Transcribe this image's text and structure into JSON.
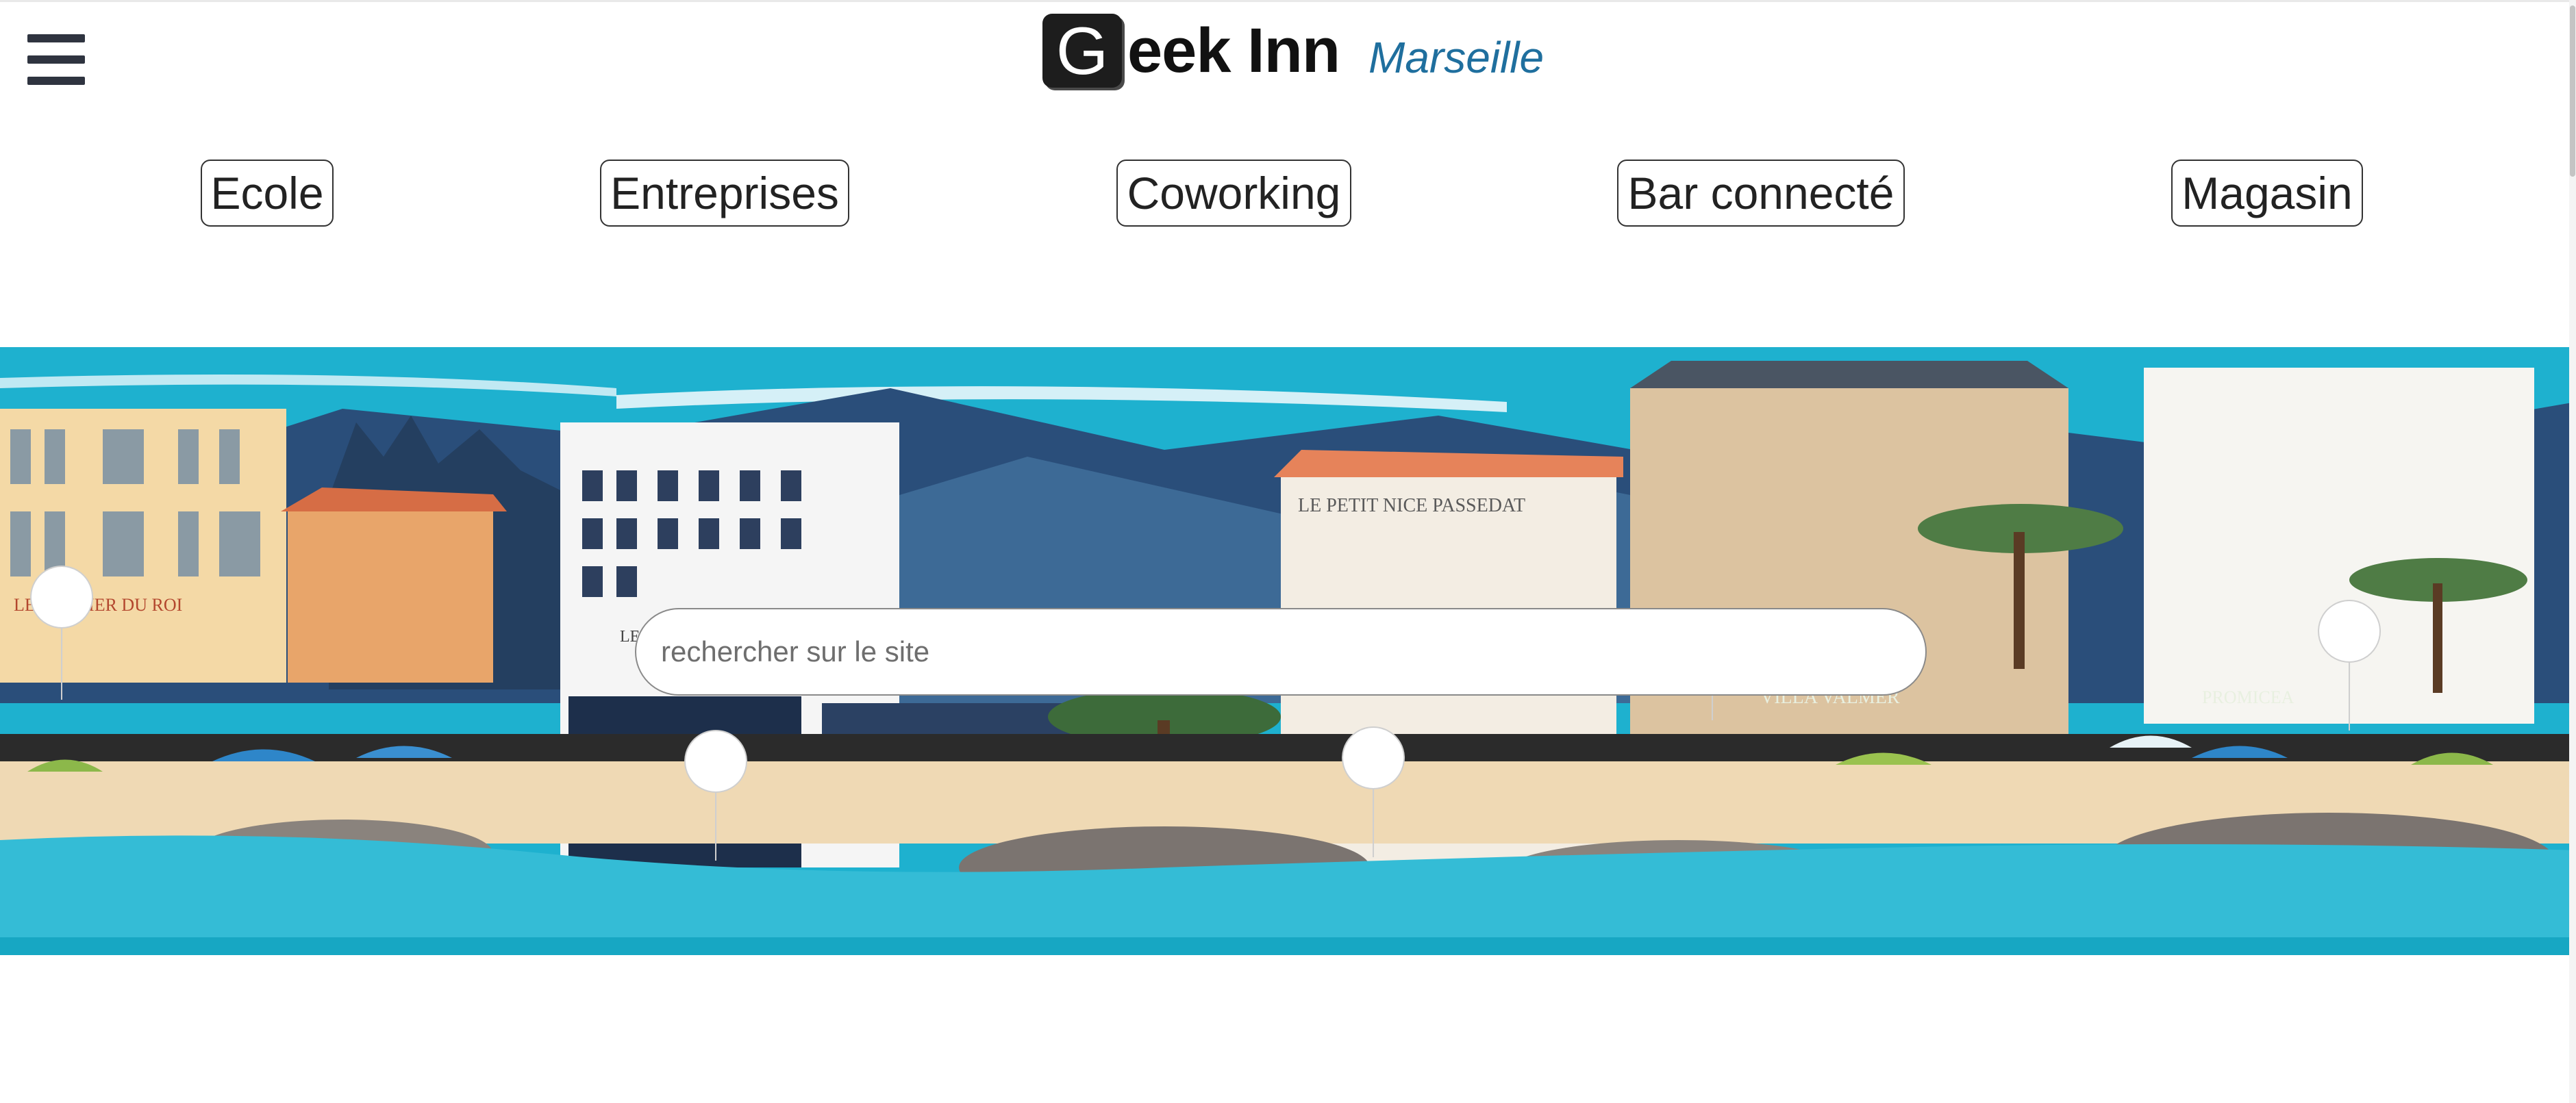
{
  "header": {
    "menu_icon": "hamburger-menu-icon",
    "logo_letter": "G",
    "logo_text": "eek Inn",
    "city": "Marseille"
  },
  "nav": [
    {
      "label": "Ecole"
    },
    {
      "label": "Entreprises"
    },
    {
      "label": "Coworking"
    },
    {
      "label": "Bar connecté"
    },
    {
      "label": "Magasin"
    }
  ],
  "hero": {
    "illustration": "Marseille coastline illustration",
    "signs": {
      "glacier": "LE GLACIER DU ROI",
      "petit_nice": "LE PETIT NICE PASSEDAT",
      "passedat": "PASSEDAT",
      "villa": "VILLA VALMER",
      "promicea": "PROMICEA",
      "le": "LE"
    }
  },
  "search": {
    "placeholder": "rechercher sur le site",
    "value": ""
  },
  "colors": {
    "accent": "#1f6f9e",
    "sky": "#1eb1cf",
    "sea": "#34bcd6"
  }
}
